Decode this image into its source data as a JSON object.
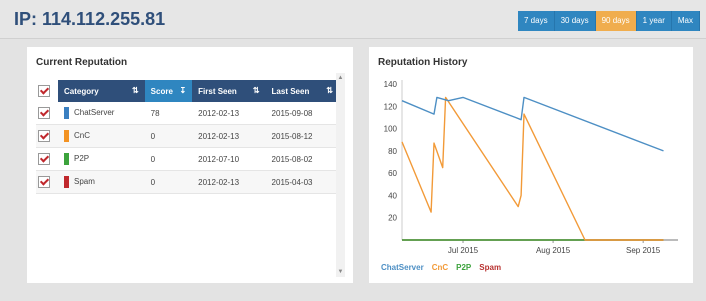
{
  "header": {
    "ip_title": "IP: 114.112.255.81",
    "ranges": [
      {
        "label": "7 days",
        "active": false
      },
      {
        "label": "30 days",
        "active": false
      },
      {
        "label": "90 days",
        "active": true
      },
      {
        "label": "1 year",
        "active": false
      },
      {
        "label": "Max",
        "active": false
      }
    ]
  },
  "reputation": {
    "title": "Current Reputation",
    "columns": {
      "category": "Category",
      "score": "Score",
      "first_seen": "First Seen",
      "last_seen": "Last Seen"
    },
    "rows": [
      {
        "category": "ChatServer",
        "color": "#3a7fc1",
        "score": "78",
        "first_seen": "2012-02-13",
        "last_seen": "2015-09-08"
      },
      {
        "category": "CnC",
        "color": "#f39323",
        "score": "0",
        "first_seen": "2012-02-13",
        "last_seen": "2015-08-12"
      },
      {
        "category": "P2P",
        "color": "#3ca33c",
        "score": "0",
        "first_seen": "2012-07-10",
        "last_seen": "2015-08-02"
      },
      {
        "category": "Spam",
        "color": "#c0282d",
        "score": "0",
        "first_seen": "2012-02-13",
        "last_seen": "2015-04-03"
      }
    ]
  },
  "history": {
    "title": "Reputation History"
  },
  "chart_data": {
    "type": "line",
    "title": "Reputation History",
    "x_ticks": [
      "Jul 2015",
      "Aug 2015",
      "Sep 2015"
    ],
    "y_ticks": [
      20,
      40,
      60,
      80,
      100,
      120,
      140
    ],
    "ylim": [
      0,
      140
    ],
    "series": [
      {
        "name": "ChatServer",
        "color": "#4d8fc4",
        "x": [
          "2015-06-10",
          "2015-06-21",
          "2015-06-22",
          "2015-06-26",
          "2015-07-01",
          "2015-07-19",
          "2015-07-21",
          "2015-07-22",
          "2015-09-08"
        ],
        "y": [
          125,
          113,
          128,
          125,
          128,
          110,
          108,
          128,
          80
        ]
      },
      {
        "name": "CnC",
        "color": "#f29a38",
        "x": [
          "2015-06-10",
          "2015-06-20",
          "2015-06-21",
          "2015-06-24",
          "2015-06-25",
          "2015-07-20",
          "2015-07-21",
          "2015-07-22",
          "2015-08-12",
          "2015-09-08"
        ],
        "y": [
          88,
          25,
          87,
          65,
          128,
          30,
          40,
          113,
          0,
          0
        ]
      },
      {
        "name": "P2P",
        "color": "#3ca33c",
        "x": [
          "2015-06-10",
          "2015-09-08"
        ],
        "y": [
          0,
          0
        ]
      },
      {
        "name": "Spam",
        "color": "#b8312f",
        "x": [
          "2015-06-10",
          "2015-09-08"
        ],
        "y": [
          0,
          0
        ]
      }
    ],
    "legend_placement": "bottom-left",
    "grid": false
  }
}
